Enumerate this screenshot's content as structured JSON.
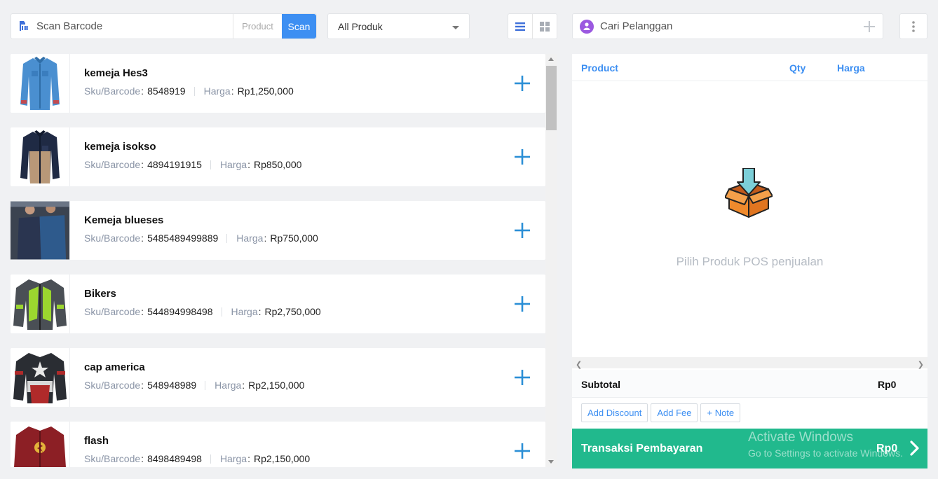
{
  "search": {
    "placeholder": "Scan Barcode",
    "mode_label": "Product",
    "scan_label": "Scan"
  },
  "category_filter": {
    "selected": "All Produk"
  },
  "view_modes": [
    "list-icon",
    "grid-icon"
  ],
  "customer": {
    "placeholder": "Cari Pelanggan"
  },
  "product_meta_labels": {
    "sku": "Sku/Barcode",
    "price": "Harga"
  },
  "products": [
    {
      "name": "kemeja Hes3",
      "sku": "8548919",
      "price": "Rp1,250,000",
      "image": "denim-shirt"
    },
    {
      "name": "kemeja isokso",
      "sku": "4894191915",
      "price": "Rp850,000",
      "image": "navy-tan-shirt"
    },
    {
      "name": "Kemeja blueses",
      "sku": "5485489499889",
      "price": "Rp750,000",
      "image": "models-shirts"
    },
    {
      "name": "Bikers",
      "sku": "544894998498",
      "price": "Rp2,750,000",
      "image": "biker-jacket"
    },
    {
      "name": "cap america",
      "sku": "548948989",
      "price": "Rp2,150,000",
      "image": "captain-jacket"
    },
    {
      "name": "flash",
      "sku": "8498489498",
      "price": "Rp2,150,000",
      "image": "flash-jacket"
    }
  ],
  "cart": {
    "columns": {
      "product": "Product",
      "qty": "Qty",
      "price": "Harga"
    },
    "empty_message": "Pilih Produk POS penjualan",
    "subtotal_label": "Subtotal",
    "subtotal_value": "Rp0",
    "actions": {
      "discount": "Add Discount",
      "fee": "Add Fee",
      "note": "+ Note"
    },
    "pay_label": "Transaksi Pembayaran",
    "pay_amount": "Rp0"
  },
  "watermark": {
    "line1": "Activate Windows",
    "line2": "Go to Settings to activate Windows."
  },
  "colors": {
    "accent": "#3d8ff2",
    "pay": "#21b98d",
    "plus": "#2b8fd6"
  }
}
